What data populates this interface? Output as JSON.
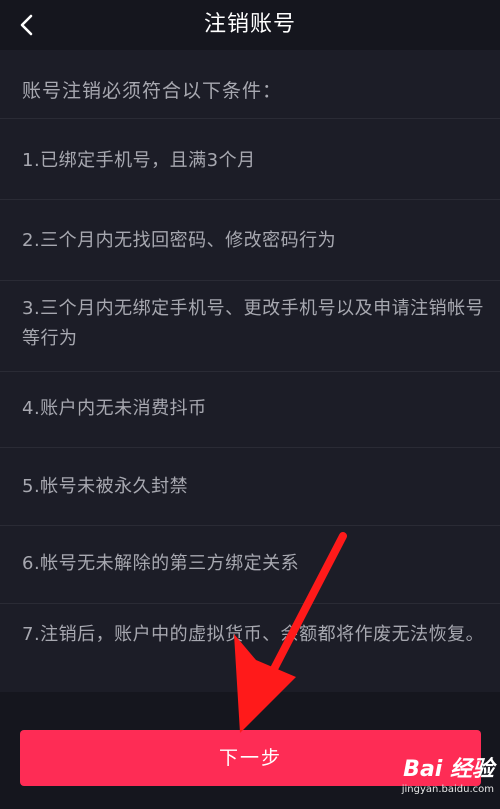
{
  "header": {
    "title": "注销账号",
    "back_icon": "chevron-left-icon"
  },
  "content": {
    "intro": "账号注销必须符合以下条件：",
    "conditions": [
      "1.已绑定手机号，且满3个月",
      "2.三个月内无找回密码、修改密码行为",
      "3.三个月内无绑定手机号、更改手机号以及申请注销帐号等行为",
      "4.账户内无未消费抖币",
      "5.帐号未被永久封禁",
      "6.帐号无未解除的第三方绑定关系",
      "7.注销后，账户中的虚拟货币、余额都将作废无法恢复。"
    ]
  },
  "footer": {
    "next_button_label": "下一步"
  },
  "watermark": {
    "logo": "Bai 经验",
    "url": "jingyan.baidu.com"
  },
  "colors": {
    "background": "#16171f",
    "content_background": "#1c1d27",
    "text": "#a7a8b0",
    "accent": "#fe2c55",
    "annotation_arrow": "#ff1a1a"
  }
}
